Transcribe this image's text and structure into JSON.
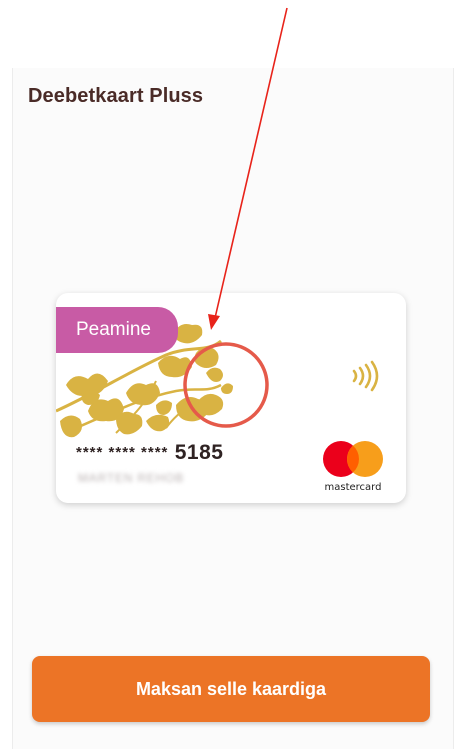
{
  "screen": {
    "title": "Deebetkaart Pluss"
  },
  "card": {
    "badge_label": "Peamine",
    "number_masked": "**** **** ****",
    "number_last4": "5185",
    "holder_name": "MARTEN REHOB",
    "brand_label": "mastercard",
    "pattern_color": "#d9b343",
    "badge_color": "#c85ba5",
    "contactless_icon": "contactless-icon",
    "mastercard_colors": [
      "#eb001b",
      "#f79e1b",
      "#ff5f00"
    ]
  },
  "annotation": {
    "arrow_color": "#e8231a",
    "circle_color": "#e55a4a"
  },
  "actions": {
    "pay_button_label": "Maksan selle kaardiga",
    "pay_button_color": "#ec7426"
  }
}
